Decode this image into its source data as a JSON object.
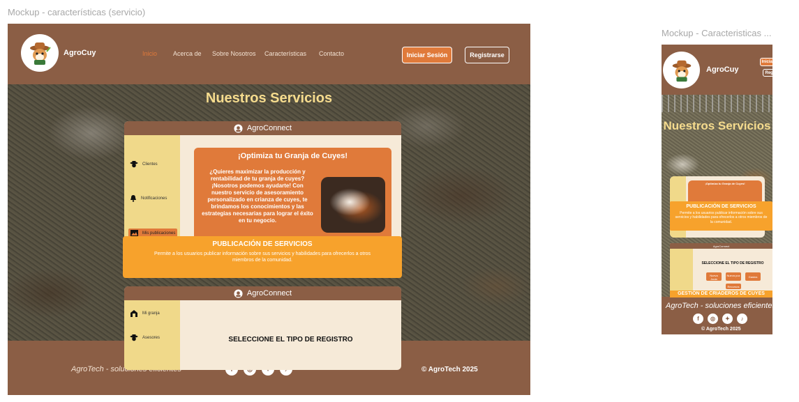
{
  "frames": {
    "desktop_label": "Mockup - características (servicio)",
    "mobile_label": "Mockup - Caracteristicas ..."
  },
  "brand": {
    "name": "AgroCuy",
    "logo_icon": "guinea-pig-farmer-logo"
  },
  "nav": {
    "items": [
      "Inicio",
      "Acerca de",
      "Sobre Nosotros",
      "Características",
      "Contacto"
    ],
    "active": "Inicio"
  },
  "auth": {
    "login": "Iniciar Sesión",
    "register": "Registrarse"
  },
  "hero": {
    "title": "Nuestros Servicios"
  },
  "app": {
    "name": "AgroConnect",
    "sidebar_1": [
      {
        "label": "Clientes",
        "icon": "user-hat-icon"
      },
      {
        "label": "Notificaciones",
        "icon": "bell-icon"
      },
      {
        "label": "Mis publicaciones",
        "icon": "image-icon"
      }
    ],
    "sidebar_2": [
      {
        "label": "Mi granja",
        "icon": "barn-icon"
      },
      {
        "label": "Asesores",
        "icon": "user-hat-icon"
      }
    ],
    "promo_title": "¡Optimiza tu Granja de Cuyes!",
    "promo_text": "¿Quieres maximizar la producción y rentabilidad de tu granja de cuyes? ¡Nosotros podemos ayudarte! Con nuestro servicio de asesoramiento personalizado en crianza de cuyes, te brindamos los conocimientos y las estrategias necesarias para lograr el éxito en tu negocio.",
    "register_heading": "SELECCIONE EL TIPO DE REGISTRO",
    "register_options": [
      "Nueva Jaula",
      "Nueva poz",
      "Gastos",
      "Recursos"
    ]
  },
  "banners": {
    "publication_title": "PUBLICACIÓN DE SERVICIOS",
    "publication_text": "Permite a los usuarios publicar información sobre sus servicios y habilidades para ofrecerlos a otros miembros de la comunidad.",
    "breeding_title": "GESTIÓN DE CRIADEROS DE CUYES"
  },
  "footer": {
    "tagline": "AgroTech - soluciones eficientes",
    "copyright": "© AgroTech 2025",
    "socials": [
      "facebook-icon",
      "instagram-icon",
      "twitter-icon",
      "tiktok-icon"
    ]
  },
  "colors": {
    "brown": "#8b5e45",
    "orange": "#e07a3a",
    "amber": "#f7a22c",
    "cream": "#f6ead8",
    "yellow_title": "#f6dc8e"
  }
}
